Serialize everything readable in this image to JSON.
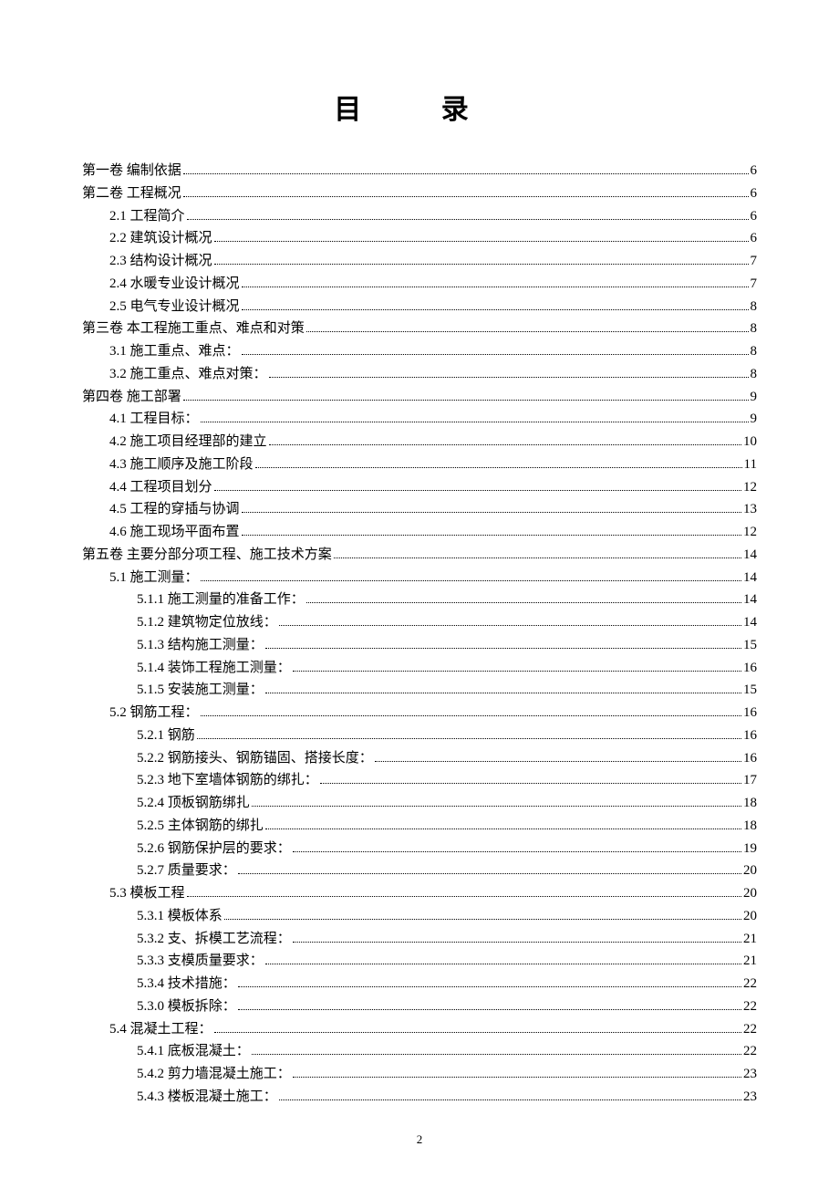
{
  "title": "目 录",
  "page_number": "2",
  "toc": [
    {
      "indent": 0,
      "label": "第一卷 编制依据",
      "page": "6"
    },
    {
      "indent": 0,
      "label": "第二卷 工程概况",
      "page": "6"
    },
    {
      "indent": 1,
      "label": "2.1 工程简介",
      "page": "6"
    },
    {
      "indent": 1,
      "label": "2.2 建筑设计概况",
      "page": "6"
    },
    {
      "indent": 1,
      "label": "2.3 结构设计概况",
      "page": "7"
    },
    {
      "indent": 1,
      "label": "2.4 水暖专业设计概况",
      "page": "7"
    },
    {
      "indent": 1,
      "label": "2.5 电气专业设计概况",
      "page": "8"
    },
    {
      "indent": 0,
      "label": "第三卷 本工程施工重点、难点和对策",
      "page": "8"
    },
    {
      "indent": 1,
      "label": "3.1 施工重点、难点：",
      "page": "8"
    },
    {
      "indent": 1,
      "label": "3.2 施工重点、难点对策：",
      "page": "8"
    },
    {
      "indent": 0,
      "label": "第四卷 施工部署",
      "page": "9"
    },
    {
      "indent": 1,
      "label": "4.1 工程目标：",
      "page": "9"
    },
    {
      "indent": 1,
      "label": "4.2 施工项目经理部的建立",
      "page": "10"
    },
    {
      "indent": 1,
      "label": "4.3 施工顺序及施工阶段",
      "page": "11"
    },
    {
      "indent": 1,
      "label": "4.4 工程项目划分",
      "page": "12"
    },
    {
      "indent": 1,
      "label": "4.5  工程的穿插与协调",
      "page": "13"
    },
    {
      "indent": 1,
      "label": "4.6 施工现场平面布置",
      "page": "12"
    },
    {
      "indent": 0,
      "label": "第五卷 主要分部分项工程、施工技术方案",
      "page": "14"
    },
    {
      "indent": 1,
      "label": "5.1 施工测量：",
      "page": "14"
    },
    {
      "indent": 2,
      "label": "5.1.1 施工测量的准备工作：",
      "page": "14"
    },
    {
      "indent": 2,
      "label": "5.1.2 建筑物定位放线：",
      "page": "14"
    },
    {
      "indent": 2,
      "label": "5.1.3 结构施工测量：",
      "page": "15"
    },
    {
      "indent": 2,
      "label": "5.1.4 装饰工程施工测量：",
      "page": "16"
    },
    {
      "indent": 2,
      "label": "5.1.5 安装施工测量：",
      "page": "15"
    },
    {
      "indent": 1,
      "label": "5.2 钢筋工程：",
      "page": "16"
    },
    {
      "indent": 2,
      "label": "5.2.1 钢筋",
      "page": "16"
    },
    {
      "indent": 2,
      "label": "5.2.2 钢筋接头、钢筋锚固、搭接长度：",
      "page": "16"
    },
    {
      "indent": 2,
      "label": "5.2.3 地下室墙体钢筋的绑扎：",
      "page": "17"
    },
    {
      "indent": 2,
      "label": "5.2.4 顶板钢筋绑扎",
      "page": "18"
    },
    {
      "indent": 2,
      "label": "5.2.5 主体钢筋的绑扎",
      "page": "18"
    },
    {
      "indent": 2,
      "label": "5.2.6 钢筋保护层的要求：",
      "page": "19"
    },
    {
      "indent": 2,
      "label": "5.2.7 质量要求：",
      "page": "20"
    },
    {
      "indent": 1,
      "label": "5.3 模板工程",
      "page": "20"
    },
    {
      "indent": 2,
      "label": "5.3.1 模板体系",
      "page": "20"
    },
    {
      "indent": 2,
      "label": "5.3.2 支、拆模工艺流程：",
      "page": "21"
    },
    {
      "indent": 2,
      "label": "5.3.3 支模质量要求：",
      "page": "21"
    },
    {
      "indent": 2,
      "label": "5.3.4 技术措施：",
      "page": "22"
    },
    {
      "indent": 2,
      "label": "5.3.0 模板拆除：",
      "page": "22"
    },
    {
      "indent": 1,
      "label": "5.4 混凝土工程：",
      "page": "22"
    },
    {
      "indent": 2,
      "label": "5.4.1 底板混凝土：",
      "page": "22"
    },
    {
      "indent": 2,
      "label": "5.4.2 剪力墙混凝土施工：",
      "page": "23"
    },
    {
      "indent": 2,
      "label": "5.4.3 楼板混凝土施工：",
      "page": "23"
    }
  ]
}
